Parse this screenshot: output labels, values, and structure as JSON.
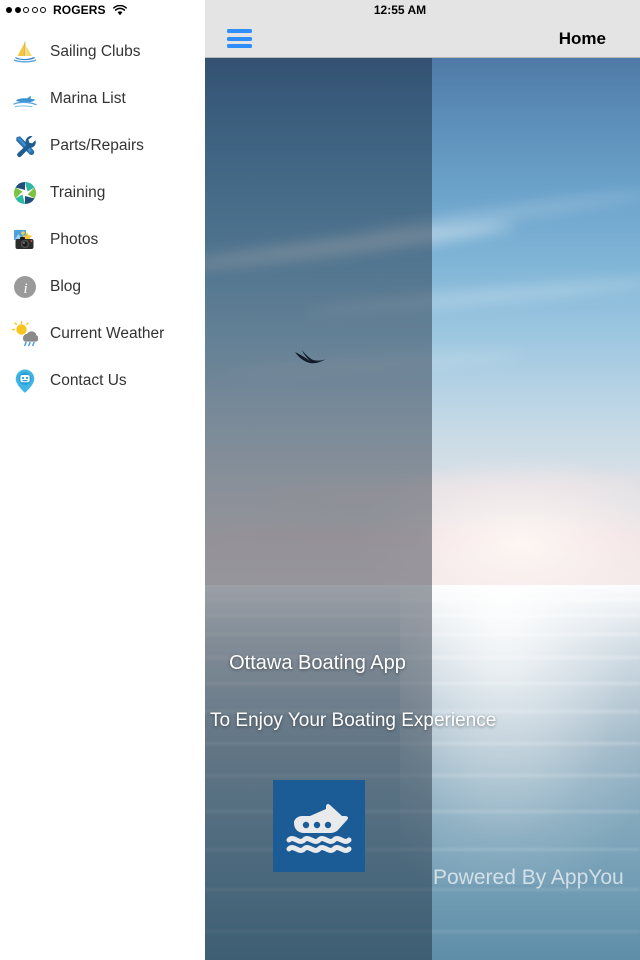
{
  "status_bar": {
    "carrier": "ROGERS",
    "signal_filled": 2,
    "signal_total": 5,
    "wifi_icon": "wifi-icon",
    "clock": "12:55 AM"
  },
  "nav_bar": {
    "menu_icon": "hamburger-icon",
    "title": "Home"
  },
  "sidebar": {
    "items": [
      {
        "label": "Sailing Clubs",
        "icon": "sailboat-icon"
      },
      {
        "label": "Marina List",
        "icon": "motorboat-icon"
      },
      {
        "label": "Parts/Repairs",
        "icon": "wrench-screwdriver-icon"
      },
      {
        "label": "Training",
        "icon": "pinwheel-icon"
      },
      {
        "label": "Photos",
        "icon": "camera-icon"
      },
      {
        "label": "Blog",
        "icon": "info-circle-icon"
      },
      {
        "label": "Current Weather",
        "icon": "sun-rain-cloud-icon"
      },
      {
        "label": "Contact Us",
        "icon": "map-pin-face-icon"
      }
    ]
  },
  "hero": {
    "title": "Ottawa Boating App",
    "subtitle": "Helping You To Enjoy Your Boating Experience",
    "logo_icon": "yacht-waves-logo",
    "footer_credit": "Powered By AppYou"
  },
  "colors": {
    "accent_blue": "#2f8eff",
    "nav_bar_bg": "#e4e4e4",
    "logo_bg": "#1c5c96",
    "sidebar_text": "#333333"
  }
}
